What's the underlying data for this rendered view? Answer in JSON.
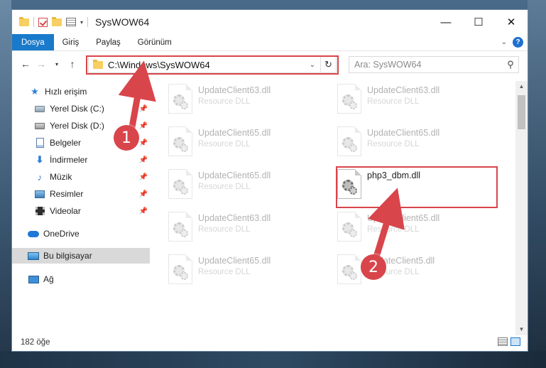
{
  "window": {
    "title": "SysWOW64",
    "controls": {
      "minimize": "—",
      "maximize": "☐",
      "close": "✕"
    }
  },
  "ribbon": {
    "tabs": [
      "Dosya",
      "Giriş",
      "Paylaş",
      "Görünüm"
    ],
    "help": "?"
  },
  "navigation": {
    "address": "C:\\Windows\\SysWOW64",
    "search_placeholder": "Ara: SysWOW64"
  },
  "sidebar": {
    "items": [
      {
        "label": "Hızlı erişim",
        "icon": "star-icon"
      },
      {
        "label": "Yerel Disk (C:)",
        "icon": "disk-icon",
        "pinned": true
      },
      {
        "label": "Yerel Disk (D:)",
        "icon": "disk-icon",
        "pinned": true
      },
      {
        "label": "Belgeler",
        "icon": "document-icon",
        "pinned": true
      },
      {
        "label": "İndirmeler",
        "icon": "download-icon",
        "pinned": true
      },
      {
        "label": "Müzik",
        "icon": "music-icon",
        "pinned": true
      },
      {
        "label": "Resimler",
        "icon": "picture-icon",
        "pinned": true
      },
      {
        "label": "Videolar",
        "icon": "video-icon",
        "pinned": true
      },
      {
        "label": "OneDrive",
        "icon": "cloud-icon"
      },
      {
        "label": "Bu bilgisayar",
        "icon": "computer-icon",
        "selected": true
      },
      {
        "label": "Ağ",
        "icon": "network-icon"
      }
    ]
  },
  "files": [
    {
      "name": "UpdateClient63.dll",
      "type": "Resource DLL"
    },
    {
      "name": "UpdateClient63.dll",
      "type": "Resource DLL"
    },
    {
      "name": "UpdateClient65.dll",
      "type": "Resource DLL"
    },
    {
      "name": "UpdateClient65.dll",
      "type": "Resource DLL"
    },
    {
      "name": "UpdateClient65.dll",
      "type": "Resource DLL"
    },
    {
      "name": "php3_dbm.dll",
      "type": "",
      "highlighted": true
    },
    {
      "name": "UpdateClient63.dll",
      "type": "Resource DLL"
    },
    {
      "name": "UpdateClient65.dll",
      "type": "Resource DLL"
    },
    {
      "name": "UpdateClient65.dll",
      "type": "Resource DLL"
    },
    {
      "name": "UpdateClient5.dll",
      "type": "Resource DLL"
    }
  ],
  "status": {
    "count": "182 öğe"
  },
  "annotations": {
    "step1": "1",
    "step2": "2",
    "color": "#d8454b"
  }
}
